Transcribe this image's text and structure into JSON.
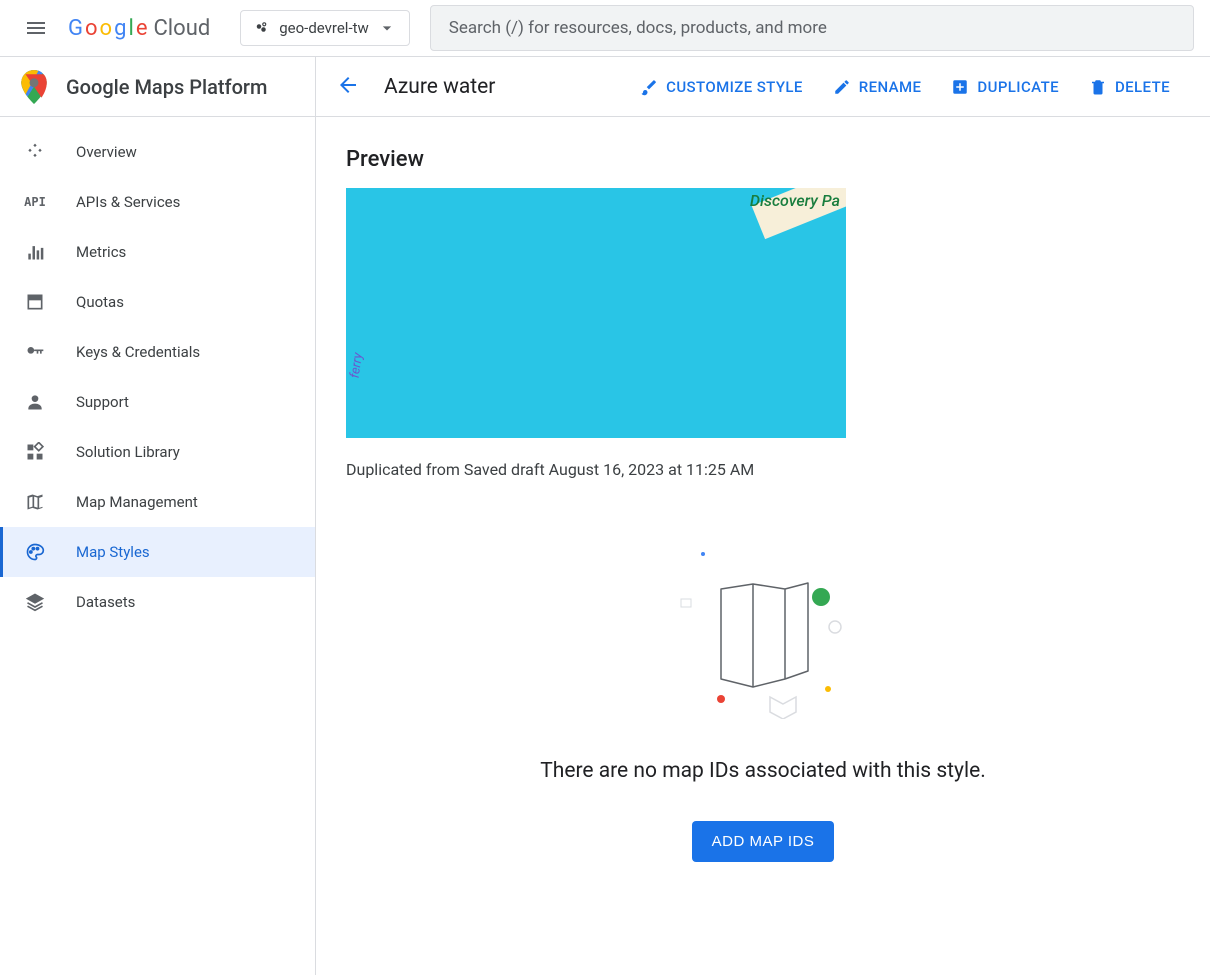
{
  "topbar": {
    "logo_text": "Cloud",
    "project_name": "geo-devrel-tw",
    "search_placeholder": "Search (/) for resources, docs, products, and more"
  },
  "sidebar": {
    "title": "Google Maps Platform",
    "items": [
      {
        "icon": "overview",
        "label": "Overview"
      },
      {
        "icon": "api",
        "label": "APIs & Services"
      },
      {
        "icon": "metrics",
        "label": "Metrics"
      },
      {
        "icon": "quotas",
        "label": "Quotas"
      },
      {
        "icon": "keys",
        "label": "Keys & Credentials"
      },
      {
        "icon": "support",
        "label": "Support"
      },
      {
        "icon": "solution",
        "label": "Solution Library"
      },
      {
        "icon": "mapmgmt",
        "label": "Map Management"
      },
      {
        "icon": "palette",
        "label": "Map Styles",
        "active": true
      },
      {
        "icon": "datasets",
        "label": "Datasets"
      }
    ]
  },
  "page": {
    "title": "Azure water",
    "actions": {
      "customize": "CUSTOMIZE STYLE",
      "rename": "RENAME",
      "duplicate": "DUPLICATE",
      "delete": "DELETE"
    },
    "preview_heading": "Preview",
    "preview_poi_label": "Discovery Pa",
    "preview_route_label": "ferry",
    "caption": "Duplicated from Saved draft August 16, 2023 at 11:25 AM",
    "empty_message": "There are no map IDs associated with this style.",
    "add_button": "ADD MAP IDS"
  }
}
